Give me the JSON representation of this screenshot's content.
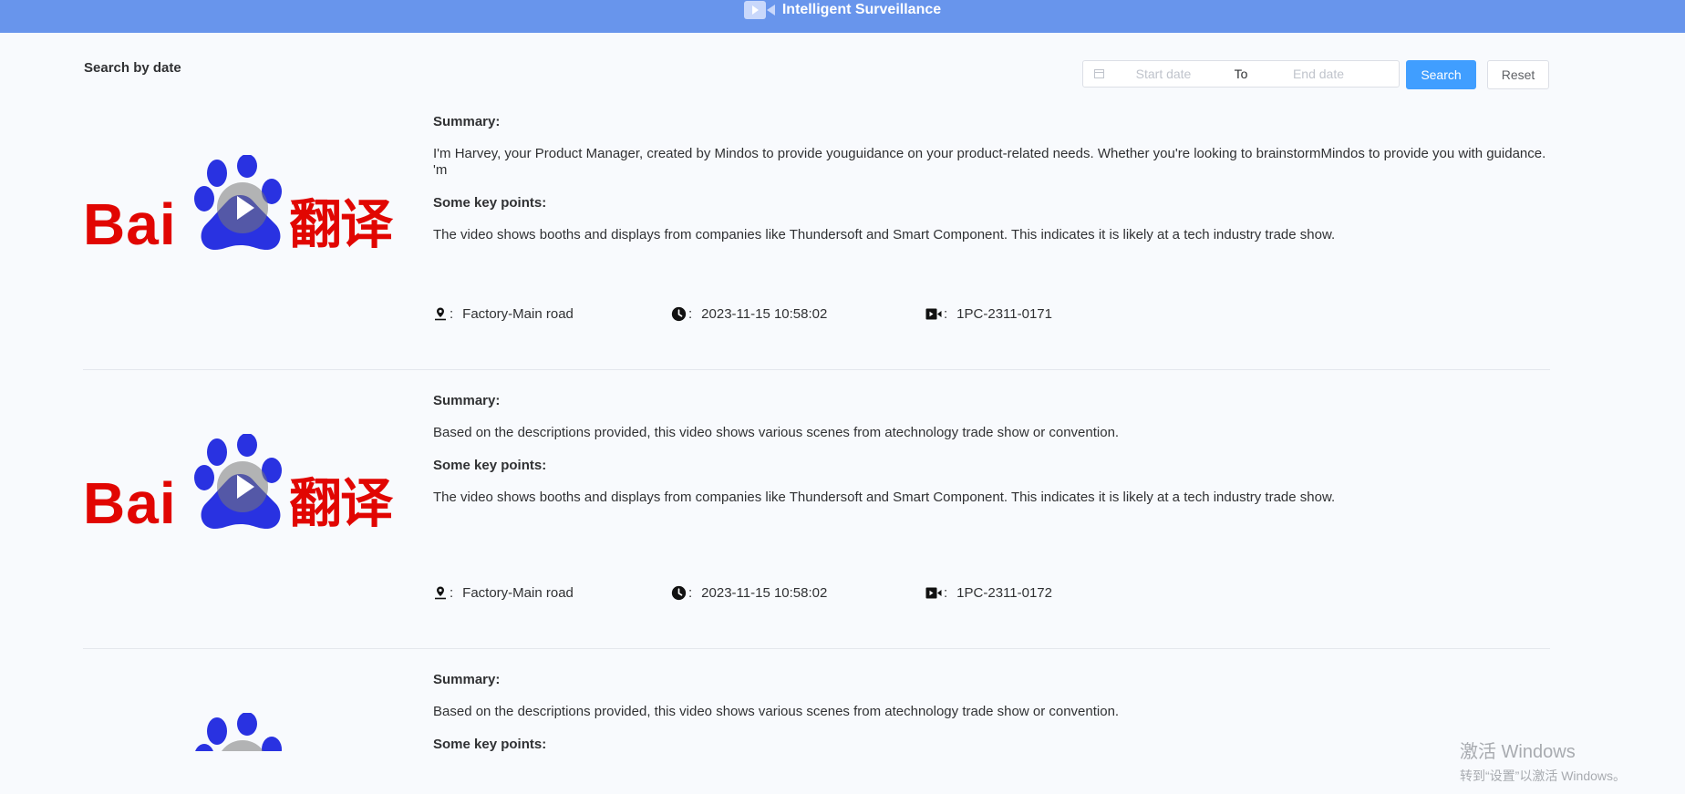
{
  "header": {
    "title": "Intelligent Surveillance"
  },
  "filter": {
    "label": "Search by date",
    "start_placeholder": "Start date",
    "separator": "To",
    "end_placeholder": "End date",
    "search_label": "Search",
    "reset_label": "Reset"
  },
  "thumbnail": {
    "logo_text": "Bai",
    "logo_cjk": "翻译"
  },
  "items": [
    {
      "summary_label": "Summary:",
      "summary": "I'm Harvey, your Product Manager, created by Mindos to provide youguidance on your product-related needs. Whether you're looking to brainstormMindos to provide you with guidance. 'm",
      "keypoints_label": "Some key points:",
      "keypoints": "The video shows booths and displays from companies like Thundersoft and Smart Component. This indicates it is likely at a tech industry trade show.",
      "location": "Factory-Main road",
      "time": "2023-11-15 10:58:02",
      "camera": "1PC-2311-0171"
    },
    {
      "summary_label": "Summary:",
      "summary": "Based on the descriptions provided, this video shows various scenes from atechnology trade show or convention.",
      "keypoints_label": "Some key points:",
      "keypoints": "The video shows booths and displays from companies like Thundersoft and Smart Component. This indicates it is likely at a tech industry trade show.",
      "location": "Factory-Main road",
      "time": "2023-11-15 10:58:02",
      "camera": "1PC-2311-0172"
    },
    {
      "summary_label": "Summary:",
      "summary": "Based on the descriptions provided, this video shows various scenes from atechnology trade show or convention.",
      "keypoints_label": "Some key points:"
    }
  ],
  "meta_colon": ":",
  "watermark": {
    "line1": "激活 Windows",
    "line2": "转到“设置”以激活 Windows。"
  },
  "colors": {
    "header_bg": "#6895ec",
    "primary": "#409eff",
    "logo_red": "#e10602",
    "logo_blue": "#2932e1"
  }
}
